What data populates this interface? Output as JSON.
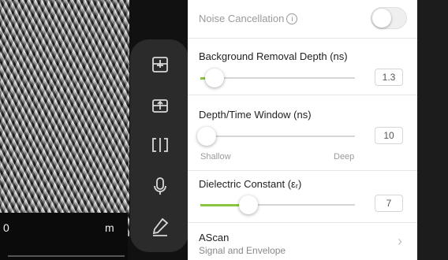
{
  "scan": {
    "axis_start_label": "0",
    "axis_unit_label": "m"
  },
  "toolbar": {
    "tools": [
      "add-scan-icon",
      "export-icon",
      "split-view-icon",
      "microphone-icon",
      "pen-icon"
    ],
    "icon_color": "#d9d9d9"
  },
  "settings": {
    "noise_cancellation": {
      "label": "Noise Cancellation",
      "info_glyph": "i",
      "enabled": false
    },
    "background_removal": {
      "label": "Background Removal Depth (ns)",
      "value": "1.3",
      "level": 0.05
    },
    "depth_window": {
      "label": "Depth/Time Window (ns)",
      "value": "10",
      "level": 0.0,
      "min_label": "Shallow",
      "max_label": "Deep"
    },
    "dielectric": {
      "label": "Dielectric Constant (εᵣ)",
      "value": "7",
      "level": 0.27
    },
    "ascan": {
      "title": "AScan",
      "subtitle": "Signal and Envelope",
      "chevron": "›"
    },
    "accent_color": "#8cc63f"
  }
}
